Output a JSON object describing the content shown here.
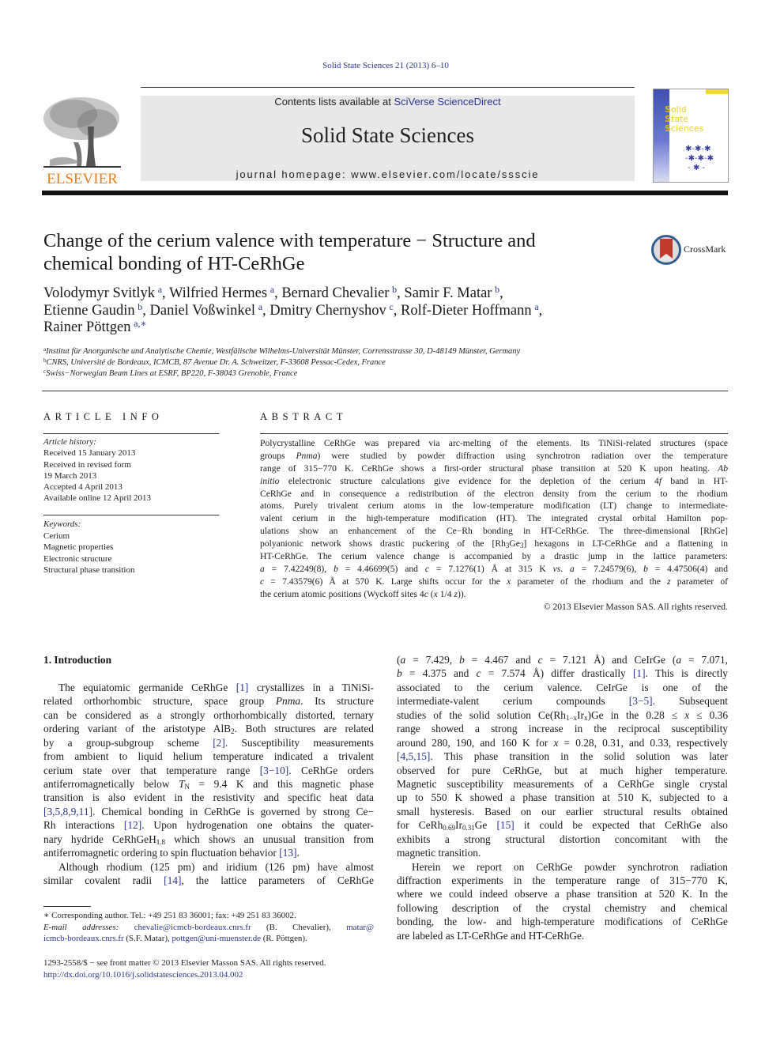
{
  "citation": "Solid State Sciences 21 (2013) 6–10",
  "masthead": {
    "contents_prefix": "Contents lists available at ",
    "contents_link": "SciVerse ScienceDirect",
    "journal_name": "Solid State Sciences",
    "homepage": "journal homepage: www.elsevier.com/locate/ssscie",
    "publisher_logo_text": "ELSEVIER",
    "cover": {
      "line1_cap": "S",
      "line1_rest": "olid",
      "line2_cap": "S",
      "line2_rest": "tate",
      "line3_cap": "S",
      "line3_rest": "ciences"
    },
    "crossmark_label": "CrossMark"
  },
  "colors": {
    "link": "#2a3590",
    "elsevier_orange": "#e8811d",
    "masthead_gray": "#e8e8e8",
    "cover_yellow": "#e9cf2e",
    "cover_blue": "#3e4fb0",
    "crossmark_red": "#c0392b"
  },
  "title": {
    "line1": "Change of the cerium valence with temperature − Structure and",
    "line2": "chemical bonding of HT-CeRhGe"
  },
  "authors": [
    {
      "name": "Volodymyr Svitlyk",
      "aff": "a",
      "sep": ", "
    },
    {
      "name": "Wilfried Hermes",
      "aff": "a",
      "sep": ", "
    },
    {
      "name": "Bernard Chevalier",
      "aff": "b",
      "sep": ", "
    },
    {
      "name": "Samir F. Matar",
      "aff": "b",
      "sep": ","
    },
    {
      "name": "Etienne Gaudin",
      "aff": "b",
      "sep": ", "
    },
    {
      "name": "Daniel Voßwinkel",
      "aff": "a",
      "sep": ", "
    },
    {
      "name": "Dmitry Chernyshov",
      "aff": "c",
      "sep": ", "
    },
    {
      "name": "Rolf-Dieter Hoffmann",
      "aff": "a",
      "sep": ","
    },
    {
      "name": "Rainer Pöttgen",
      "aff": "a,∗",
      "sep": ""
    }
  ],
  "affiliations": [
    {
      "key": "a",
      "text": "Institut für Anorganische und Analytische Chemie, Westfälische Wilhelms-Universität Münster, Corrensstrasse 30, D-48149 Münster, Germany"
    },
    {
      "key": "b",
      "text": "CNRS, Université de Bordeaux, ICMCB, 87 Avenue Dr. A. Schweitzer, F-33608 Pessac-Cedex, France"
    },
    {
      "key": "c",
      "text": "Swiss−Norwegian Beam Lines at ESRF, BP220, F-38043 Grenoble, France"
    }
  ],
  "article_info": {
    "heading": "ARTICLE INFO",
    "history_label": "Article history:",
    "history": [
      "Received 15 January 2013",
      "Received in revised form",
      "19 March 2013",
      "Accepted 4 April 2013",
      "Available online 12 April 2013"
    ],
    "keywords_label": "Keywords:",
    "keywords": [
      "Cerium",
      "Magnetic properties",
      "Electronic structure",
      "Structural phase transition"
    ]
  },
  "abstract": {
    "heading": "ABSTRACT",
    "lines": [
      "Polycrystalline CeRhGe was prepared via arc-melting of the elements. Its TiNiSi-related structures (space",
      "groups |Pnma|) were studied by powder diffraction using synchrotron radiation over the temperature",
      "range of 315−770 K. CeRhGe shows a first-order structural phase transition at 520 K upon heating. |Ab|",
      "|initio| elelectronic structure calculations give evidence for the depletion of the cerium 4|f| band in HT-",
      "CeRhGe and in consequence a redistribution of the electron density from the cerium to the rhodium",
      "atoms. Purely trivalent cerium atoms in the low-temperature modification (LT) change to intermediate-",
      "valent cerium in the high-temperature modification (HT). The integrated crystal orbital Hamilton pop-",
      "ulations show an enhancement of the Ce−Rh bonding in HT-CeRhGe. The three-dimensional [RhGe]",
      "polyanionic network shows drastic puckering of the [Rh~3~Ge~3~] hexagons in LT-CeRhGe and a flattening in",
      "HT-CeRhGe. The cerium valence change is accompanied by a drastic jump in the lattice parameters:",
      "|a| = 7.42249(8), |b| = 4.46699(5) and |c| = 7.1276(1) Å at 315 K |vs|. |a| = 7.24579(6), |b| = 4.47506(4) and",
      "|c| = 7.43579(6) Å at 570 K. Large shifts occur for the |x| parameter of the rhodium and the |z| parameter of",
      "the cerium atomic positions (Wyckoff sites 4|c| (|x| 1/4 |z|))."
    ],
    "copyright": "© 2013 Elsevier Masson SAS. All rights reserved."
  },
  "introduction": {
    "heading": "1.  Introduction",
    "left_lines": [
      {
        "t": "The equiatomic germanide CeRhGe {[1]} crystallizes in a TiNiSi-",
        "ind": true
      },
      {
        "t": "related orthorhombic structure, space group |Pnma|. Its structure"
      },
      {
        "t": "can be considered as a strongly orthorhombically distorted, ternary"
      },
      {
        "t": "ordering variant of the aristotype AlB~2~. Both structures are related"
      },
      {
        "t": "by a group-subgroup scheme {[2]}. Susceptibility measurements"
      },
      {
        "t": "from ambient to liquid helium temperature indicated a trivalent"
      },
      {
        "t": "cerium state over that temperature range {[3−10]}. CeRhGe orders"
      },
      {
        "t": "antiferromagnetically below |T|~N~ = 9.4 K and this magnetic phase"
      },
      {
        "t": "transition is also evident in the resistivity and specific heat data"
      },
      {
        "t": "{[3,5,8,9,11]}. Chemical bonding in CeRhGe is governed by strong Ce−"
      },
      {
        "t": "Rh interactions {[12]}. Upon hydrogenation one obtains the quater-"
      },
      {
        "t": "nary hydride CeRhGeH~1.8~ which shows an unusual transition from"
      },
      {
        "t": "antiferromagnetic ordering to spin fluctuation behavior {[13]}.",
        "last": true
      },
      {
        "t": "Although rhodium (125 pm) and iridium (126 pm) have almost",
        "ind": true
      },
      {
        "t": "similar covalent radii {[14]}, the lattice parameters of CeRhGe"
      }
    ],
    "right_lines": [
      {
        "t": "(|a| = 7.429, |b| = 4.467 and |c| = 7.121 Å) and CeIrGe (|a| = 7.071,"
      },
      {
        "t": "|b| = 4.375 and |c| = 7.574 Å) differ drastically {[1]}. This is directly"
      },
      {
        "t": "associated to the cerium valence. CeIrGe is one of the"
      },
      {
        "t": "intermediate-valent cerium compounds {[3−5]}. Subsequent"
      },
      {
        "t": "studies of the solid solution Ce(Rh~1−x~Ir~x~)Ge in the 0.28 ≤ |x| ≤ 0.36"
      },
      {
        "t": "range showed a strong increase in the reciprocal susceptibility"
      },
      {
        "t": "around 280, 190, and 160 K for |x| = 0.28, 0.31, and 0.33, respectively"
      },
      {
        "t": "{[4,5,15]}. This phase transition in the solid solution was later"
      },
      {
        "t": "observed for pure CeRhGe, but at much higher temperature."
      },
      {
        "t": "Magnetic susceptibility measurements of a CeRhGe single crystal"
      },
      {
        "t": "up to 550 K showed a phase transition at 510 K, subjected to a"
      },
      {
        "t": "small hysteresis. Based on our earlier structural results obtained"
      },
      {
        "t": "for CeRh~0.69~Ir~0.31~Ge {[15]} it could be expected that CeRhGe also"
      },
      {
        "t": "exhibits a strong structural distortion concomitant with the"
      },
      {
        "t": "magnetic transition.",
        "last": true
      },
      {
        "t": "Herein we report on CeRhGe powder synchrotron radiation",
        "ind": true
      },
      {
        "t": "diffraction experiments in the temperature range of 315−770 K,"
      },
      {
        "t": "where we could indeed observe a phase transition at 520 K. In the"
      },
      {
        "t": "following description of the crystal chemistry and chemical"
      },
      {
        "t": "bonding, the low- and high-temperature modifications of CeRhGe"
      },
      {
        "t": "are labeled as LT-CeRhGe and HT-CeRhGe.",
        "last": true
      }
    ]
  },
  "footnotes": {
    "lines": [
      {
        "t": "∗ Corresponding author. Tel.: +49 251 83 36001; fax: +49 251 83 36002.",
        "ind": true,
        "last": true
      },
      {
        "t": "|E-mail addresses:| {chevalie@icmcb-bordeaux.cnrs.fr} (B. Chevalier), {matar@}",
        "ind": true
      },
      {
        "t": "{icmcb-bordeaux.cnrs.fr} (S.F. Matar), {pottgen@uni-muenster.de} (R. Pöttgen).",
        "last": true
      }
    ],
    "front_matter": "1293-2558/$ − see front matter © 2013 Elsevier Masson SAS. All rights reserved.",
    "doi": "http://dx.doi.org/10.1016/j.solidstatesciences.2013.04.002"
  }
}
